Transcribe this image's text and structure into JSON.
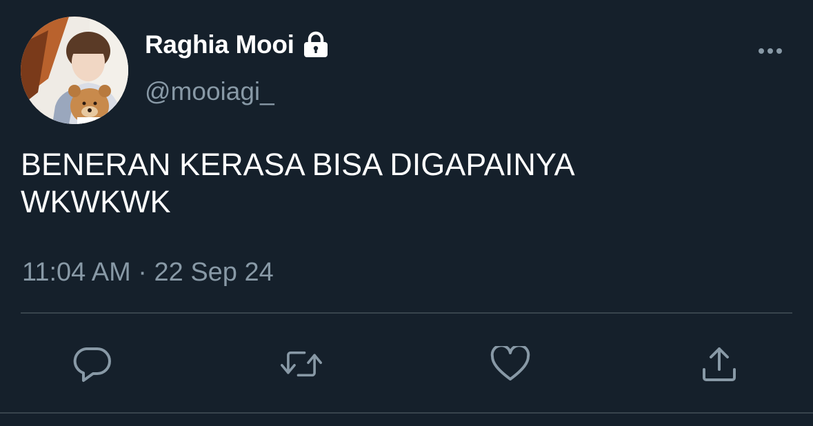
{
  "user": {
    "display_name": "Raghia Mooi",
    "handle": "@mooiagi_",
    "protected_icon": "lock-icon",
    "avatar": "profile-avatar"
  },
  "tweet": {
    "text": "BENERAN KERASA BISA DIGAPAINYA\nWKWKWK",
    "timestamp": "11:04 AM · 22 Sep 24"
  },
  "menu": {
    "icon": "more-options-icon"
  },
  "actions": [
    {
      "name": "reply",
      "icon": "reply-icon"
    },
    {
      "name": "retweet",
      "icon": "retweet-icon"
    },
    {
      "name": "like",
      "icon": "like-icon"
    },
    {
      "name": "share",
      "icon": "share-icon"
    }
  ],
  "colors": {
    "background": "#15202b",
    "primary_text": "#ffffff",
    "secondary_text": "#8899a6",
    "divider": "#38444d"
  }
}
